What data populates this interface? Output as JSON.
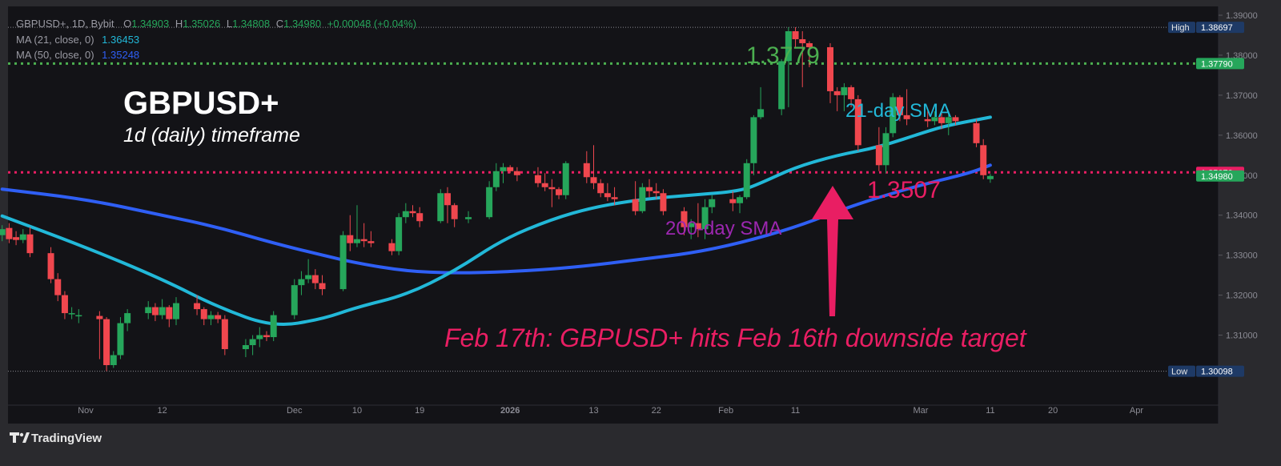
{
  "header": {
    "symbol": "GBPUSD+, 1D, Bybit",
    "ohlc": [
      {
        "k": "O",
        "v": "1.34903"
      },
      {
        "k": "H",
        "v": "1.35026"
      },
      {
        "k": "L",
        "v": "1.34808"
      },
      {
        "k": "C",
        "v": "1.34980"
      }
    ],
    "change": "+0.00048 (+0.04%)",
    "indicators": [
      {
        "label": "MA (21, close, 0)",
        "value": "1.36453",
        "color": "#22b8d8"
      },
      {
        "label": "MA (50, close, 0)",
        "value": "1.35248",
        "color": "#2f5ff5"
      }
    ]
  },
  "overlay": {
    "title": "GBPUSD+",
    "subtitle": "1d (daily) timeframe",
    "level_high_text": "1.3779",
    "level_low_text": "1.3507",
    "sma21_text": "21-day SMA",
    "sma200_text": "200-day SMA",
    "headline": "Feb 17th: GBPUSD+ hits Feb 16th downside target"
  },
  "footer": {
    "brand": "TradingView"
  },
  "colors": {
    "background": "#131317",
    "up": "#26a65b",
    "down": "#f0474e",
    "sma21": "#22b8d8",
    "sma50": "#2f5ff5",
    "level_high": "#4caf50",
    "level_low": "#e91e63",
    "annotation_purple": "#9c27b0"
  },
  "chart_data": {
    "type": "candlestick",
    "ylim": [
      1.2995,
      1.39
    ],
    "y_ticks": [
      "1.31000",
      "1.32000",
      "1.33000",
      "1.34000",
      "1.35000",
      "1.36000",
      "1.37000",
      "1.38000",
      "1.39000"
    ],
    "x_ticks": [
      {
        "label": "Nov",
        "date": "2025-11-01"
      },
      {
        "label": "12",
        "date": "2025-11-12"
      },
      {
        "label": "Dec",
        "date": "2025-12-01"
      },
      {
        "label": "10",
        "date": "2025-12-10"
      },
      {
        "label": "19",
        "date": "2025-12-19"
      },
      {
        "label": "2026",
        "date": "2026-01-01",
        "bold": true
      },
      {
        "label": "13",
        "date": "2026-01-13"
      },
      {
        "label": "22",
        "date": "2026-01-22"
      },
      {
        "label": "Feb",
        "date": "2026-02-01"
      },
      {
        "label": "11",
        "date": "2026-02-11"
      },
      {
        "label": "Mar",
        "date": "2026-03-01"
      },
      {
        "label": "11",
        "date": "2026-03-11"
      },
      {
        "label": "20",
        "date": "2026-03-20"
      },
      {
        "label": "Apr",
        "date": "2026-04-01"
      }
    ],
    "price_labels": [
      {
        "tag": "High",
        "value": "1.38697",
        "y": 1.38697,
        "tag_color": "#1e3a66",
        "box_color": "#1e3a66",
        "line": "dotted"
      },
      {
        "value": "1.37790",
        "y": 1.3779,
        "box_color": "#26a65b"
      },
      {
        "value": "1.35070",
        "y": 1.3507,
        "box_color": "#e91e63"
      },
      {
        "value": "1.34980",
        "y": 1.3498,
        "box_color": "#26a65b"
      },
      {
        "tag": "Low",
        "value": "1.30098",
        "y": 1.30098,
        "tag_color": "#1e3a66",
        "box_color": "#1e3a66",
        "line": "dotted"
      }
    ],
    "levels": [
      {
        "y": 1.3779,
        "color": "#4caf50"
      },
      {
        "y": 1.3507,
        "color": "#e91e63"
      }
    ],
    "candles": [
      {
        "date": "2025-10-20",
        "o": 1.335,
        "h": 1.3375,
        "l": 1.3335,
        "c": 1.3365
      },
      {
        "date": "2025-10-21",
        "o": 1.3368,
        "h": 1.338,
        "l": 1.333,
        "c": 1.334
      },
      {
        "date": "2025-10-22",
        "o": 1.3345,
        "h": 1.336,
        "l": 1.3325,
        "c": 1.3338
      },
      {
        "date": "2025-10-23",
        "o": 1.3338,
        "h": 1.3365,
        "l": 1.333,
        "c": 1.3352
      },
      {
        "date": "2025-10-24",
        "o": 1.3352,
        "h": 1.337,
        "l": 1.3295,
        "c": 1.3305
      },
      {
        "date": "2025-10-27",
        "o": 1.3305,
        "h": 1.332,
        "l": 1.323,
        "c": 1.324
      },
      {
        "date": "2025-10-28",
        "o": 1.324,
        "h": 1.3255,
        "l": 1.3185,
        "c": 1.32
      },
      {
        "date": "2025-10-29",
        "o": 1.32,
        "h": 1.321,
        "l": 1.314,
        "c": 1.3155
      },
      {
        "date": "2025-10-30",
        "o": 1.3152,
        "h": 1.317,
        "l": 1.314,
        "c": 1.3155
      },
      {
        "date": "2025-10-31",
        "o": 1.315,
        "h": 1.3165,
        "l": 1.313,
        "c": 1.315
      },
      {
        "date": "2025-11-03",
        "o": 1.3148,
        "h": 1.316,
        "l": 1.304,
        "c": 1.314
      },
      {
        "date": "2025-11-04",
        "o": 1.314,
        "h": 1.3145,
        "l": 1.301,
        "c": 1.3025
      },
      {
        "date": "2025-11-05",
        "o": 1.3025,
        "h": 1.306,
        "l": 1.3018,
        "c": 1.305
      },
      {
        "date": "2025-11-06",
        "o": 1.305,
        "h": 1.3145,
        "l": 1.304,
        "c": 1.313
      },
      {
        "date": "2025-11-07",
        "o": 1.313,
        "h": 1.3165,
        "l": 1.311,
        "c": 1.3155
      },
      {
        "date": "2025-11-10",
        "o": 1.3155,
        "h": 1.3185,
        "l": 1.314,
        "c": 1.317
      },
      {
        "date": "2025-11-11",
        "o": 1.317,
        "h": 1.318,
        "l": 1.3135,
        "c": 1.315
      },
      {
        "date": "2025-11-12",
        "o": 1.315,
        "h": 1.319,
        "l": 1.314,
        "c": 1.317
      },
      {
        "date": "2025-11-13",
        "o": 1.317,
        "h": 1.3175,
        "l": 1.312,
        "c": 1.314
      },
      {
        "date": "2025-11-14",
        "o": 1.314,
        "h": 1.3195,
        "l": 1.3125,
        "c": 1.318
      },
      {
        "date": "2025-11-17",
        "o": 1.318,
        "h": 1.32,
        "l": 1.315,
        "c": 1.3165
      },
      {
        "date": "2025-11-18",
        "o": 1.3165,
        "h": 1.317,
        "l": 1.3125,
        "c": 1.314
      },
      {
        "date": "2025-11-19",
        "o": 1.314,
        "h": 1.316,
        "l": 1.3125,
        "c": 1.315
      },
      {
        "date": "2025-11-20",
        "o": 1.315,
        "h": 1.3158,
        "l": 1.313,
        "c": 1.314
      },
      {
        "date": "2025-11-21",
        "o": 1.314,
        "h": 1.315,
        "l": 1.305,
        "c": 1.3065
      },
      {
        "date": "2025-11-24",
        "o": 1.3065,
        "h": 1.309,
        "l": 1.3045,
        "c": 1.3075
      },
      {
        "date": "2025-11-25",
        "o": 1.3075,
        "h": 1.31,
        "l": 1.305,
        "c": 1.309
      },
      {
        "date": "2025-11-26",
        "o": 1.309,
        "h": 1.312,
        "l": 1.307,
        "c": 1.31
      },
      {
        "date": "2025-11-27",
        "o": 1.31,
        "h": 1.311,
        "l": 1.3085,
        "c": 1.3095
      },
      {
        "date": "2025-11-28",
        "o": 1.3095,
        "h": 1.316,
        "l": 1.3085,
        "c": 1.315
      },
      {
        "date": "2025-12-01",
        "o": 1.315,
        "h": 1.324,
        "l": 1.314,
        "c": 1.3225
      },
      {
        "date": "2025-12-02",
        "o": 1.3225,
        "h": 1.326,
        "l": 1.32,
        "c": 1.324
      },
      {
        "date": "2025-12-03",
        "o": 1.324,
        "h": 1.329,
        "l": 1.323,
        "c": 1.325
      },
      {
        "date": "2025-12-04",
        "o": 1.325,
        "h": 1.3265,
        "l": 1.3215,
        "c": 1.323
      },
      {
        "date": "2025-12-05",
        "o": 1.323,
        "h": 1.325,
        "l": 1.32,
        "c": 1.3215
      },
      {
        "date": "2025-12-08",
        "o": 1.3215,
        "h": 1.336,
        "l": 1.321,
        "c": 1.335
      },
      {
        "date": "2025-12-09",
        "o": 1.335,
        "h": 1.34,
        "l": 1.331,
        "c": 1.333
      },
      {
        "date": "2025-12-10",
        "o": 1.333,
        "h": 1.3425,
        "l": 1.332,
        "c": 1.334
      },
      {
        "date": "2025-12-11",
        "o": 1.334,
        "h": 1.338,
        "l": 1.332,
        "c": 1.3335
      },
      {
        "date": "2025-12-12",
        "o": 1.3335,
        "h": 1.336,
        "l": 1.332,
        "c": 1.333
      },
      {
        "date": "2025-12-15",
        "o": 1.333,
        "h": 1.334,
        "l": 1.33,
        "c": 1.331
      },
      {
        "date": "2025-12-16",
        "o": 1.331,
        "h": 1.3405,
        "l": 1.33,
        "c": 1.3395
      },
      {
        "date": "2025-12-17",
        "o": 1.3395,
        "h": 1.343,
        "l": 1.338,
        "c": 1.341
      },
      {
        "date": "2025-12-18",
        "o": 1.341,
        "h": 1.3425,
        "l": 1.3395,
        "c": 1.3405
      },
      {
        "date": "2025-12-19",
        "o": 1.3405,
        "h": 1.342,
        "l": 1.337,
        "c": 1.3385
      },
      {
        "date": "2025-12-22",
        "o": 1.3385,
        "h": 1.3465,
        "l": 1.338,
        "c": 1.3455
      },
      {
        "date": "2025-12-23",
        "o": 1.3455,
        "h": 1.347,
        "l": 1.338,
        "c": 1.3425
      },
      {
        "date": "2025-12-24",
        "o": 1.3425,
        "h": 1.343,
        "l": 1.337,
        "c": 1.339
      },
      {
        "date": "2025-12-26",
        "o": 1.339,
        "h": 1.341,
        "l": 1.338,
        "c": 1.3395
      },
      {
        "date": "2025-12-29",
        "o": 1.3395,
        "h": 1.3485,
        "l": 1.339,
        "c": 1.347
      },
      {
        "date": "2025-12-30",
        "o": 1.347,
        "h": 1.353,
        "l": 1.346,
        "c": 1.351
      },
      {
        "date": "2025-12-31",
        "o": 1.351,
        "h": 1.353,
        "l": 1.348,
        "c": 1.352
      },
      {
        "date": "2026-01-01",
        "o": 1.352,
        "h": 1.3525,
        "l": 1.3505,
        "c": 1.351
      },
      {
        "date": "2026-01-02",
        "o": 1.351,
        "h": 1.352,
        "l": 1.3485,
        "c": 1.35
      },
      {
        "date": "2026-01-05",
        "o": 1.35,
        "h": 1.352,
        "l": 1.347,
        "c": 1.348
      },
      {
        "date": "2026-01-06",
        "o": 1.348,
        "h": 1.3505,
        "l": 1.346,
        "c": 1.347
      },
      {
        "date": "2026-01-07",
        "o": 1.347,
        "h": 1.349,
        "l": 1.342,
        "c": 1.3465
      },
      {
        "date": "2026-01-08",
        "o": 1.3465,
        "h": 1.347,
        "l": 1.344,
        "c": 1.345
      },
      {
        "date": "2026-01-09",
        "o": 1.345,
        "h": 1.3535,
        "l": 1.344,
        "c": 1.353
      },
      {
        "date": "2026-01-12",
        "o": 1.353,
        "h": 1.356,
        "l": 1.348,
        "c": 1.3495
      },
      {
        "date": "2026-01-13",
        "o": 1.3495,
        "h": 1.3575,
        "l": 1.3465,
        "c": 1.348
      },
      {
        "date": "2026-01-14",
        "o": 1.348,
        "h": 1.349,
        "l": 1.3445,
        "c": 1.3455
      },
      {
        "date": "2026-01-15",
        "o": 1.3455,
        "h": 1.348,
        "l": 1.3435,
        "c": 1.3445
      },
      {
        "date": "2026-01-16",
        "o": 1.3445,
        "h": 1.347,
        "l": 1.3425,
        "c": 1.344
      },
      {
        "date": "2026-01-19",
        "o": 1.344,
        "h": 1.3485,
        "l": 1.34,
        "c": 1.341
      },
      {
        "date": "2026-01-20",
        "o": 1.341,
        "h": 1.348,
        "l": 1.3405,
        "c": 1.347
      },
      {
        "date": "2026-01-21",
        "o": 1.347,
        "h": 1.349,
        "l": 1.3445,
        "c": 1.346
      },
      {
        "date": "2026-01-22",
        "o": 1.346,
        "h": 1.348,
        "l": 1.344,
        "c": 1.3455
      },
      {
        "date": "2026-01-23",
        "o": 1.3455,
        "h": 1.3465,
        "l": 1.34,
        "c": 1.341
      },
      {
        "date": "2026-01-26",
        "o": 1.341,
        "h": 1.342,
        "l": 1.335,
        "c": 1.337
      },
      {
        "date": "2026-01-27",
        "o": 1.337,
        "h": 1.339,
        "l": 1.334,
        "c": 1.338
      },
      {
        "date": "2026-01-28",
        "o": 1.338,
        "h": 1.343,
        "l": 1.3345,
        "c": 1.3365
      },
      {
        "date": "2026-01-29",
        "o": 1.3365,
        "h": 1.344,
        "l": 1.334,
        "c": 1.342
      },
      {
        "date": "2026-01-30",
        "o": 1.342,
        "h": 1.345,
        "l": 1.3405,
        "c": 1.344
      },
      {
        "date": "2026-02-02",
        "o": 1.344,
        "h": 1.346,
        "l": 1.341,
        "c": 1.343
      },
      {
        "date": "2026-02-03",
        "o": 1.343,
        "h": 1.345,
        "l": 1.3405,
        "c": 1.3445
      },
      {
        "date": "2026-02-04",
        "o": 1.3445,
        "h": 1.354,
        "l": 1.344,
        "c": 1.353
      },
      {
        "date": "2026-02-05",
        "o": 1.353,
        "h": 1.365,
        "l": 1.35,
        "c": 1.3645
      },
      {
        "date": "2026-02-06",
        "o": 1.3645,
        "h": 1.372,
        "l": 1.364,
        "c": 1.3665
      },
      {
        "date": "2026-02-09",
        "o": 1.3665,
        "h": 1.379,
        "l": 1.365,
        "c": 1.3785
      },
      {
        "date": "2026-02-10",
        "o": 1.3785,
        "h": 1.387,
        "l": 1.367,
        "c": 1.386
      },
      {
        "date": "2026-02-11",
        "o": 1.386,
        "h": 1.387,
        "l": 1.382,
        "c": 1.384
      },
      {
        "date": "2026-02-12",
        "o": 1.384,
        "h": 1.386,
        "l": 1.372,
        "c": 1.383
      },
      {
        "date": "2026-02-13",
        "o": 1.383,
        "h": 1.3835,
        "l": 1.377,
        "c": 1.382
      },
      {
        "date": "2026-02-16",
        "o": 1.382,
        "h": 1.383,
        "l": 1.368,
        "c": 1.371
      },
      {
        "date": "2026-02-17",
        "o": 1.371,
        "h": 1.372,
        "l": 1.366,
        "c": 1.37
      },
      {
        "date": "2026-02-18",
        "o": 1.37,
        "h": 1.373,
        "l": 1.366,
        "c": 1.372
      },
      {
        "date": "2026-02-19",
        "o": 1.372,
        "h": 1.3725,
        "l": 1.367,
        "c": 1.369
      },
      {
        "date": "2026-02-20",
        "o": 1.369,
        "h": 1.37,
        "l": 1.356,
        "c": 1.3575
      },
      {
        "date": "2026-02-23",
        "o": 1.3575,
        "h": 1.362,
        "l": 1.351,
        "c": 1.3525
      },
      {
        "date": "2026-02-24",
        "o": 1.3525,
        "h": 1.362,
        "l": 1.3505,
        "c": 1.3605
      },
      {
        "date": "2026-02-25",
        "o": 1.3605,
        "h": 1.3705,
        "l": 1.3595,
        "c": 1.3695
      },
      {
        "date": "2026-02-26",
        "o": 1.3695,
        "h": 1.37,
        "l": 1.3635,
        "c": 1.365
      },
      {
        "date": "2026-02-27",
        "o": 1.365,
        "h": 1.3715,
        "l": 1.3625,
        "c": 1.364
      },
      {
        "date": "2026-03-02",
        "o": 1.364,
        "h": 1.366,
        "l": 1.362,
        "c": 1.3635
      },
      {
        "date": "2026-03-03",
        "o": 1.3635,
        "h": 1.366,
        "l": 1.3625,
        "c": 1.3645
      },
      {
        "date": "2026-03-04",
        "o": 1.3645,
        "h": 1.3655,
        "l": 1.3615,
        "c": 1.363
      },
      {
        "date": "2026-03-05",
        "o": 1.363,
        "h": 1.366,
        "l": 1.36,
        "c": 1.3645
      },
      {
        "date": "2026-03-06",
        "o": 1.3645,
        "h": 1.365,
        "l": 1.3625,
        "c": 1.3635
      },
      {
        "date": "2026-03-09",
        "o": 1.363,
        "h": 1.364,
        "l": 1.357,
        "c": 1.358
      },
      {
        "date": "2026-03-10",
        "o": 1.3575,
        "h": 1.359,
        "l": 1.349,
        "c": 1.35
      },
      {
        "date": "2026-03-11",
        "o": 1.349,
        "h": 1.3503,
        "l": 1.3481,
        "c": 1.3498
      }
    ],
    "sma21": [
      {
        "date": "2025-10-20",
        "v": 1.3398
      },
      {
        "date": "2025-11-01",
        "v": 1.332
      },
      {
        "date": "2025-11-12",
        "v": 1.324
      },
      {
        "date": "2025-11-20",
        "v": 1.317
      },
      {
        "date": "2025-11-28",
        "v": 1.312
      },
      {
        "date": "2025-12-05",
        "v": 1.314
      },
      {
        "date": "2025-12-10",
        "v": 1.317
      },
      {
        "date": "2025-12-17",
        "v": 1.32
      },
      {
        "date": "2025-12-24",
        "v": 1.326
      },
      {
        "date": "2025-12-31",
        "v": 1.334
      },
      {
        "date": "2026-01-07",
        "v": 1.339
      },
      {
        "date": "2026-01-13",
        "v": 1.342
      },
      {
        "date": "2026-01-20",
        "v": 1.344
      },
      {
        "date": "2026-01-27",
        "v": 1.345
      },
      {
        "date": "2026-02-03",
        "v": 1.346
      },
      {
        "date": "2026-02-06",
        "v": 1.348
      },
      {
        "date": "2026-02-11",
        "v": 1.352
      },
      {
        "date": "2026-02-17",
        "v": 1.355
      },
      {
        "date": "2026-02-23",
        "v": 1.357
      },
      {
        "date": "2026-03-02",
        "v": 1.361
      },
      {
        "date": "2026-03-05",
        "v": 1.3625
      },
      {
        "date": "2026-03-11",
        "v": 1.3645
      }
    ],
    "sma50": [
      {
        "date": "2025-10-20",
        "v": 1.3465
      },
      {
        "date": "2025-11-01",
        "v": 1.344
      },
      {
        "date": "2025-11-12",
        "v": 1.34
      },
      {
        "date": "2025-11-20",
        "v": 1.337
      },
      {
        "date": "2025-11-28",
        "v": 1.333
      },
      {
        "date": "2025-12-05",
        "v": 1.33
      },
      {
        "date": "2025-12-10",
        "v": 1.328
      },
      {
        "date": "2025-12-17",
        "v": 1.326
      },
      {
        "date": "2025-12-24",
        "v": 1.3255
      },
      {
        "date": "2025-12-31",
        "v": 1.3258
      },
      {
        "date": "2026-01-07",
        "v": 1.3265
      },
      {
        "date": "2026-01-13",
        "v": 1.3275
      },
      {
        "date": "2026-01-20",
        "v": 1.329
      },
      {
        "date": "2026-01-27",
        "v": 1.3305
      },
      {
        "date": "2026-02-03",
        "v": 1.333
      },
      {
        "date": "2026-02-11",
        "v": 1.337
      },
      {
        "date": "2026-02-17",
        "v": 1.341
      },
      {
        "date": "2026-02-23",
        "v": 1.3445
      },
      {
        "date": "2026-03-02",
        "v": 1.348
      },
      {
        "date": "2026-03-08",
        "v": 1.3505
      },
      {
        "date": "2026-03-11",
        "v": 1.3525
      }
    ]
  }
}
